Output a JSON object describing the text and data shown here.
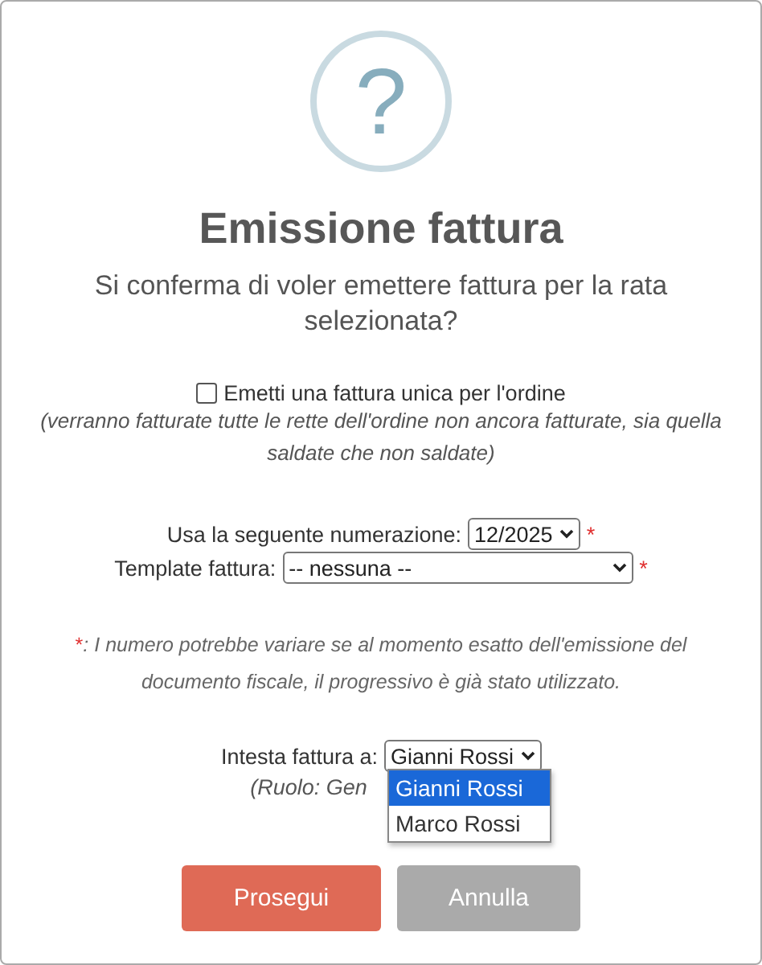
{
  "dialog": {
    "icon_glyph": "?",
    "title": "Emissione fattura",
    "question": "Si conferma di voler emettere fattura per la rata selezionata?",
    "single_invoice": {
      "label": "Emetti una fattura unica per l'ordine",
      "checked": false,
      "note": "(verranno fatturate tutte le rette dell'ordine non ancora fatturate, sia quella saldate che non saldate)"
    },
    "fields": [
      {
        "label": "Usa la seguente numerazione:",
        "value": "12/2025",
        "required_mark": "*",
        "wide": false
      },
      {
        "label": "Template fattura:",
        "value": "-- nessuna --",
        "required_mark": "*",
        "wide": true
      }
    ],
    "footnote": {
      "mark": "*",
      "text": ": I numero potrebbe variare se al momento esatto dell'emissione del documento fiscale, il progressivo è già stato utilizzato."
    },
    "recipient": {
      "label": "Intesta fattura a:",
      "value": "Gianni Rossi",
      "role_note": "(Ruolo: Gen",
      "expanded": true,
      "options": [
        {
          "label": "Gianni Rossi",
          "selected": true
        },
        {
          "label": "Marco Rossi",
          "selected": false
        }
      ]
    },
    "buttons": [
      {
        "label": "Prosegui",
        "kind": "primary"
      },
      {
        "label": "Annulla",
        "kind": "secondary"
      }
    ]
  }
}
